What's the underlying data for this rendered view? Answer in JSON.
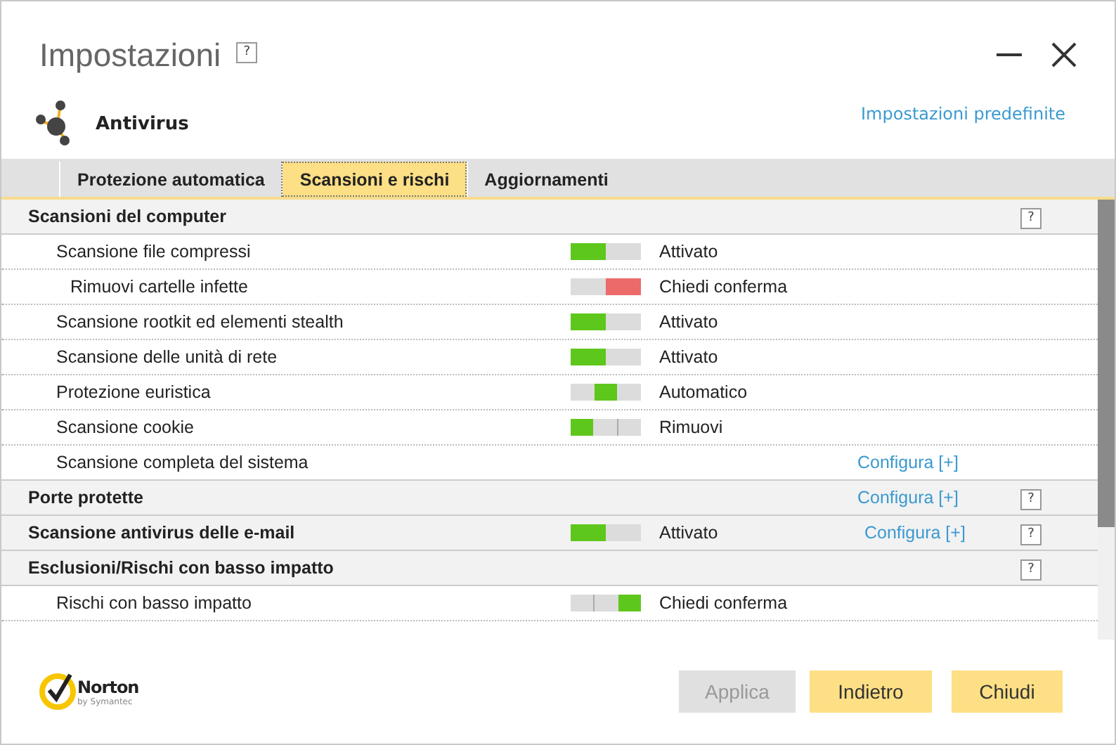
{
  "window": {
    "title": "Impostazioni",
    "help": "?"
  },
  "header": {
    "title": "Antivirus",
    "link": "Impostazioni predefinite"
  },
  "tabs": [
    {
      "label": "Protezione automatica",
      "selected": false
    },
    {
      "label": "Scansioni e rischi",
      "selected": true
    },
    {
      "label": "Aggiornamenti",
      "selected": false
    }
  ],
  "sections": [
    {
      "title": "Scansioni del computer",
      "help": "?",
      "rows": [
        {
          "label": "Scansione file compressi",
          "switch": {
            "color": "#5ec71c",
            "segments": [
              {
                "selected": true
              },
              {
                "selected": false
              }
            ]
          },
          "state": "Attivato",
          "children": [
            {
              "label": "Rimuovi cartelle infette",
              "switch": {
                "color": "#ec6a6a",
                "segments": [
                  {
                    "selected": false
                  },
                  {
                    "selected": true
                  }
                ]
              },
              "state": "Chiedi conferma"
            }
          ]
        },
        {
          "label": "Scansione rootkit ed elementi stealth",
          "switch": {
            "color": "#5ec71c",
            "segments": [
              {
                "selected": true
              },
              {
                "selected": false
              }
            ]
          },
          "state": "Attivato"
        },
        {
          "label": "Scansione delle unità di rete",
          "switch": {
            "color": "#5ec71c",
            "segments": [
              {
                "selected": true
              },
              {
                "selected": false
              }
            ]
          },
          "state": "Attivato"
        },
        {
          "label": "Protezione euristica",
          "switch": {
            "color": "#5ec71c",
            "segments": [
              {
                "selected": false
              },
              {
                "selected": true
              },
              {
                "selected": false
              }
            ]
          },
          "state": "Automatico"
        },
        {
          "label": "Scansione cookie",
          "switch": {
            "color": "#5ec71c",
            "segments": [
              {
                "selected": true
              },
              {
                "selected": false
              },
              {
                "selected": false
              }
            ]
          },
          "state": "Rimuovi"
        },
        {
          "label": "Scansione completa del sistema",
          "link": "Configura [+]"
        }
      ]
    },
    {
      "title": "Porte protette",
      "link": "Configura [+]",
      "help": "?"
    },
    {
      "title": "Scansione antivirus delle e-mail",
      "switch": {
        "color": "#5ec71c",
        "segments": [
          {
            "selected": true
          },
          {
            "selected": false
          }
        ]
      },
      "state": "Attivato",
      "link": "Configura [+]",
      "help": "?"
    },
    {
      "title": "Esclusioni/Rischi con basso impatto",
      "help": "?",
      "rows": [
        {
          "label": "Rischi con basso impatto",
          "switch": {
            "color": "#5ec71c",
            "segments": [
              {
                "selected": false
              },
              {
                "selected": false
              },
              {
                "selected": true
              }
            ]
          },
          "state": "Chiedi conferma"
        }
      ]
    }
  ],
  "logo": {
    "name": "Norton",
    "tagline": "by Symantec"
  },
  "buttons": [
    {
      "label": "Applica",
      "disabled": true
    },
    {
      "label": "Indietro",
      "disabled": false
    },
    {
      "label": "Chiudi",
      "disabled": false
    }
  ]
}
